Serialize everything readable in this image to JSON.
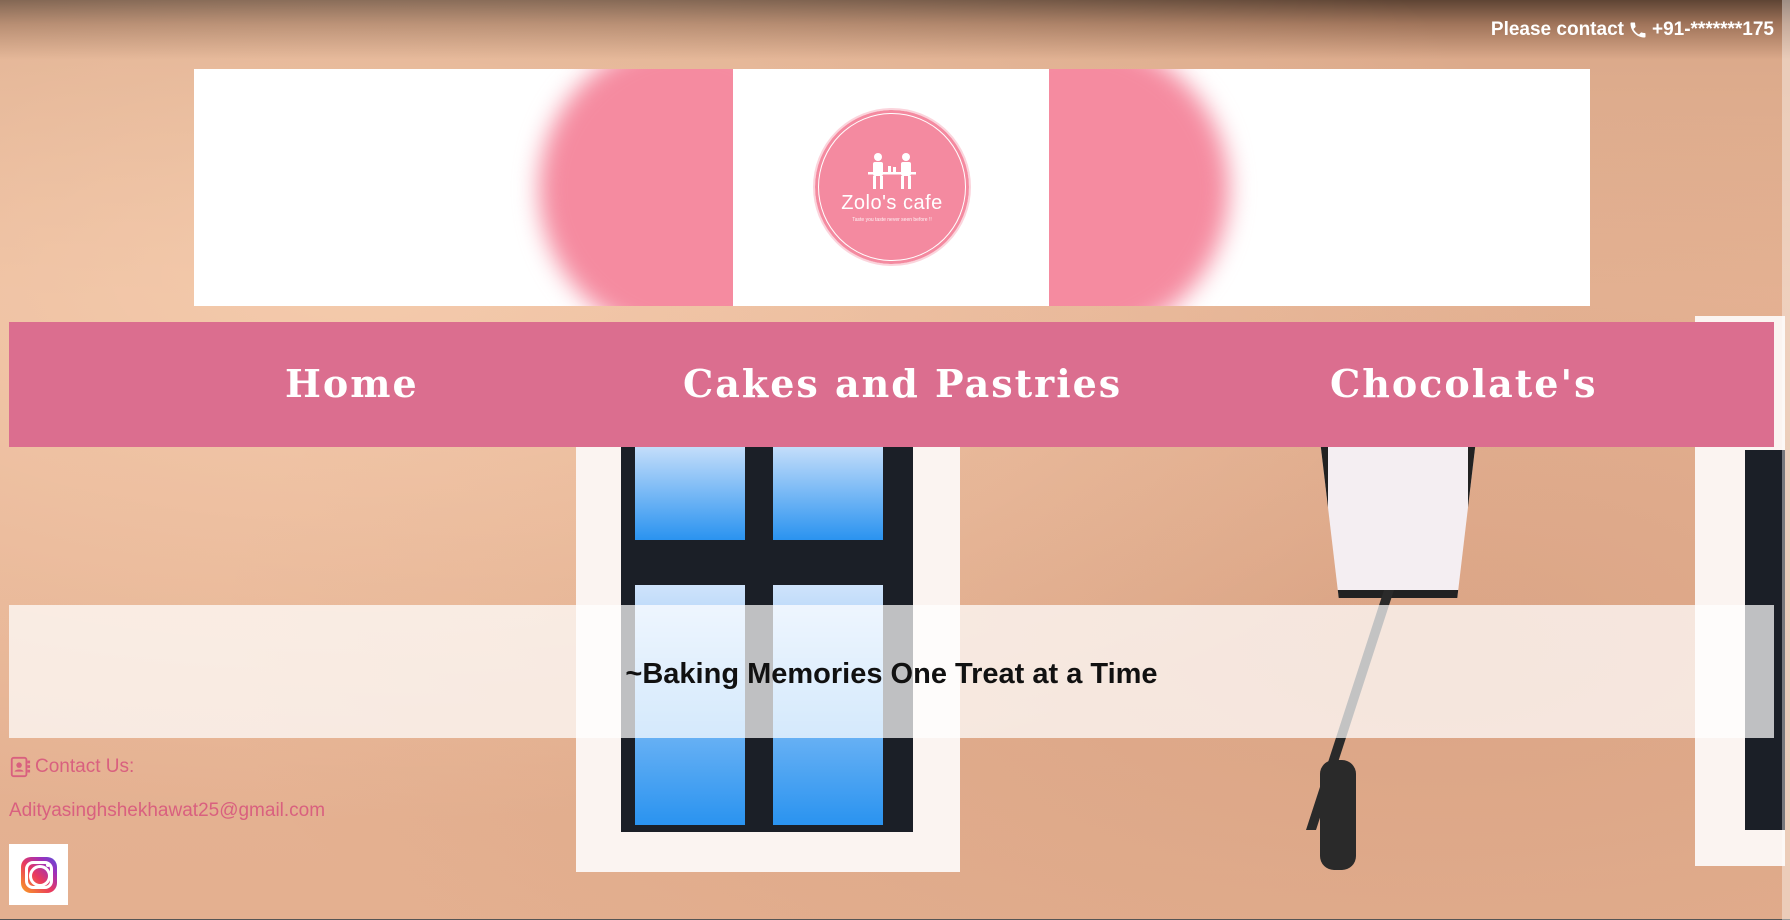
{
  "top_bar": {
    "contact_label": "Please contact",
    "phone_icon": "phone-icon",
    "phone": "+91-*******175"
  },
  "banner": {
    "brand_name": "Zolo's cafe",
    "brand_tagline": "Taste you taste never seen before !!",
    "logo_color": "#f48aa0"
  },
  "nav": {
    "items": [
      {
        "label": "Home"
      },
      {
        "label": "Cakes and Pastries"
      },
      {
        "label": "Chocolate's"
      }
    ],
    "color": "#db6e8f"
  },
  "hero": {
    "tagline": "~Baking Memories One Treat at a Time"
  },
  "footer": {
    "contact_icon": "contact-card-icon",
    "contact_label": "Contact Us:",
    "email": "Adityasinghshekhawat25@gmail.com",
    "social_icon": "instagram-icon",
    "accent_color": "#d9607f"
  }
}
